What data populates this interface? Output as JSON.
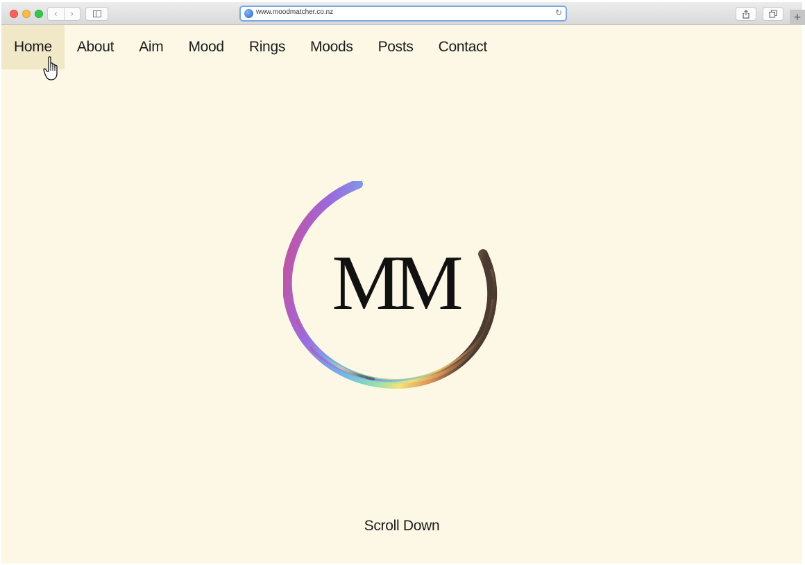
{
  "browser": {
    "url": "www.moodmatcher.co.nz"
  },
  "nav": {
    "items": [
      "Home",
      "About",
      "Aim",
      "Mood",
      "Rings",
      "Moods",
      "Posts",
      "Contact"
    ],
    "active": "Home"
  },
  "hero": {
    "logo_text": "MM",
    "scroll_label": "Scroll Down"
  },
  "colors": {
    "page_background": "#fdf8e6",
    "active_nav_background": "#f1e8c8",
    "logo_text": "#111111",
    "url_focus_ring": "#7aa7e6"
  },
  "icons": {
    "back": "chevron-left-icon",
    "forward": "chevron-right-icon",
    "sidebar": "sidebar-icon",
    "globe": "globe-icon",
    "reload": "reload-icon",
    "share": "share-icon",
    "tabs": "tabs-overview-icon",
    "new_tab": "plus-icon",
    "cursor": "hand-pointer-icon"
  }
}
